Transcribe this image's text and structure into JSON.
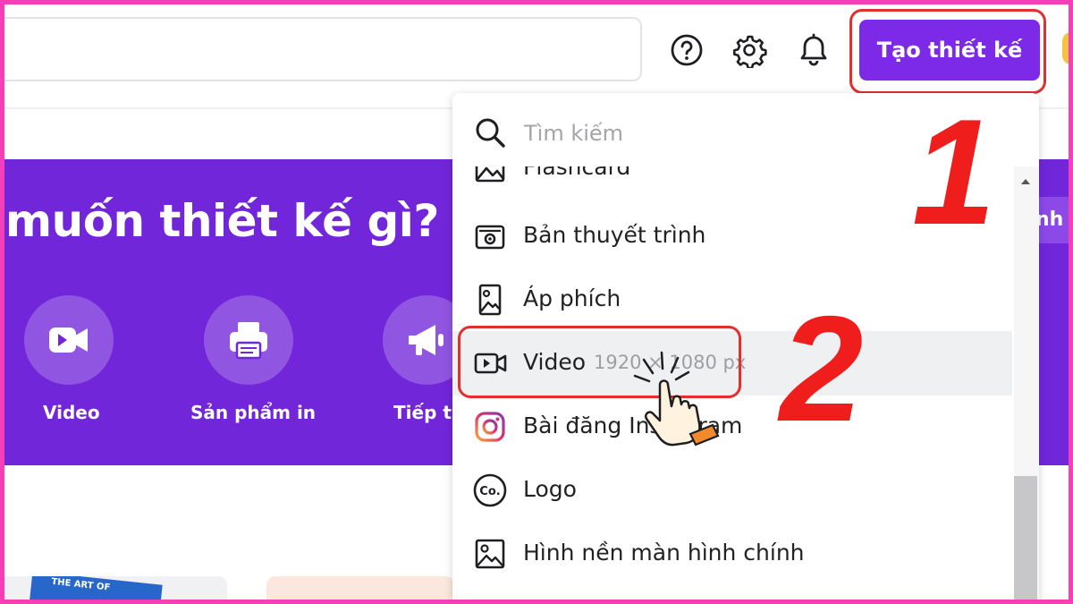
{
  "topbar": {
    "search_value": "",
    "create_button": "Tạo thiết kế",
    "icons": [
      "help-icon",
      "settings-icon",
      "notification-bell-icon"
    ]
  },
  "banner": {
    "title": "muốn thiết kế gì?",
    "side_tab": "nh",
    "categories": [
      {
        "label": "Video",
        "icon": "video-camera-icon"
      },
      {
        "label": "Sản phẩm in",
        "icon": "printer-icon"
      },
      {
        "label": "Tiếp th",
        "icon": "megaphone-icon"
      }
    ]
  },
  "dropdown": {
    "search_placeholder": "Tìm kiếm",
    "items": [
      {
        "label": "Flashcard",
        "icon": "image-icon"
      },
      {
        "label": "Bản thuyết trình",
        "icon": "presentation-icon"
      },
      {
        "label": "Áp phích",
        "icon": "poster-icon"
      },
      {
        "label": "Video",
        "dimensions": "1920 × 1080 px",
        "icon": "video-icon",
        "highlighted": true
      },
      {
        "label": "Bài đăng Instagram",
        "icon": "instagram-icon"
      },
      {
        "label": "Logo",
        "icon": "logo-icon"
      },
      {
        "label": "Hình nền màn hình chính",
        "icon": "wallpaper-icon"
      }
    ]
  },
  "annotations": {
    "step1": "1",
    "step2": "2"
  },
  "thumbnails": {
    "book_text": "THE ART OF"
  },
  "colors": {
    "brand_purple": "#7d2ae8",
    "banner_purple": "#7126d9",
    "highlight_red": "#e2302f",
    "frame_pink": "#f53fb6"
  }
}
